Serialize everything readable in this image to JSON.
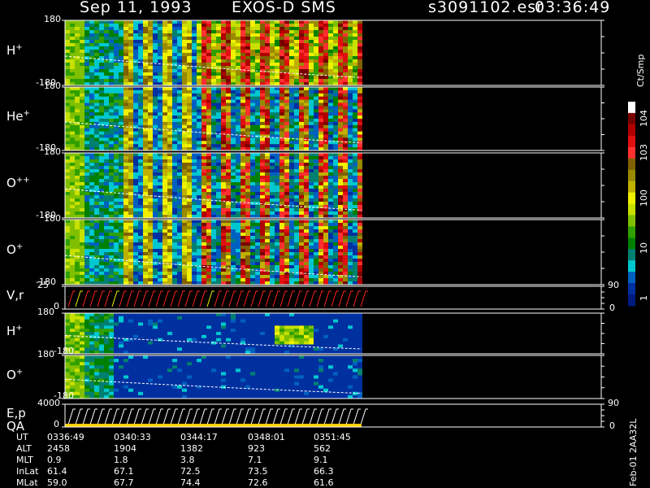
{
  "header": {
    "date": "Sep 11, 1993",
    "instrument": "EXOS-D SMS",
    "file": "s3091102.esr",
    "time": "03:36:49"
  },
  "panels": [
    {
      "label": "H",
      "charge": "+",
      "top_tick": "180",
      "bottom_tick": "-180"
    },
    {
      "label": "He",
      "charge": "+",
      "top_tick": "180",
      "bottom_tick": "-180"
    },
    {
      "label": "O",
      "charge": "++",
      "top_tick": "180",
      "bottom_tick": "-180"
    },
    {
      "label": "O",
      "charge": "+",
      "top_tick": "180",
      "bottom_tick": "-180"
    },
    {
      "label": "V,r",
      "charge": "",
      "top_tick": "25",
      "bottom_tick": "0",
      "right_top_tick": "90",
      "right_bottom_tick": "0"
    },
    {
      "label": "H",
      "charge": "+",
      "top_tick": "180",
      "bottom_tick": "-180"
    },
    {
      "label": "O",
      "charge": "+",
      "top_tick": "180",
      "bottom_tick": "-180"
    },
    {
      "label": "E,p",
      "label2": "QA",
      "top_tick": "4000",
      "bottom_tick": "0",
      "right_top_tick": "90",
      "right_bottom_tick": "0"
    }
  ],
  "colorbar": {
    "unit": "Ct/Smp",
    "labels": [
      "10^4",
      "10^3",
      "100",
      "10",
      "1"
    ],
    "colors": [
      "#ffffff",
      "#7a0000",
      "#b00000",
      "#e01010",
      "#ff3030",
      "#806000",
      "#9a8a00",
      "#c0b000",
      "#f0f000",
      "#c8e000",
      "#80c000",
      "#30a000",
      "#008000",
      "#008070",
      "#00c8d0",
      "#0060c0",
      "#0030a0",
      "#001a80"
    ]
  },
  "chart_data": {
    "type": "heatmap",
    "title": "Sep 11, 1993  EXOS-D SMS",
    "x_label": "UT",
    "x_ticks": [
      "0336:49",
      "0340:33",
      "0344:17",
      "0348:01",
      "0351:45"
    ],
    "colorbar_unit": "Ct/Smp",
    "colorbar_ticks": [
      "1",
      "10",
      "100",
      "10^3",
      "10^4"
    ],
    "ephemeris": {
      "rows": [
        {
          "name": "UT",
          "values": [
            "0336:49",
            "0340:33",
            "0344:17",
            "0348:01",
            "0351:45"
          ]
        },
        {
          "name": "ALT",
          "values": [
            "2458",
            "1904",
            "1382",
            "923",
            "562"
          ]
        },
        {
          "name": "MLT",
          "values": [
            "0.9",
            "1.8",
            "3.8",
            "7.1",
            "9.1"
          ]
        },
        {
          "name": "InLat",
          "values": [
            "61.4",
            "67.1",
            "72.5",
            "73.5",
            "66.3"
          ]
        },
        {
          "name": "MLat",
          "values": [
            "59.0",
            "67.7",
            "74.4",
            "72.6",
            "61.6"
          ]
        }
      ]
    }
  },
  "footer_code": "Feb-01 2AA32L"
}
